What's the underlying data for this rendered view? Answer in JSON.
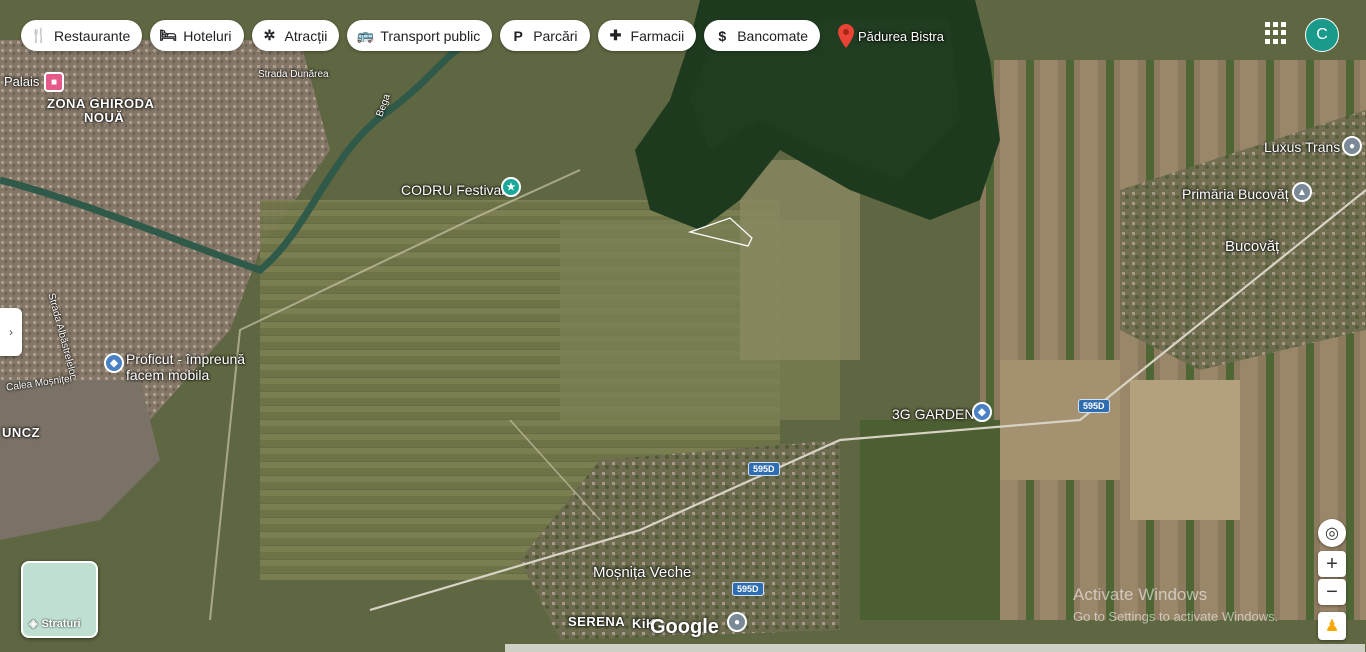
{
  "chips": [
    {
      "label": "Restaurante",
      "icon": "fork-knife-icon",
      "glyph": "🍴"
    },
    {
      "label": "Hoteluri",
      "icon": "bed-icon",
      "glyph": "🛏"
    },
    {
      "label": "Atracții",
      "icon": "attraction-icon",
      "glyph": "✲"
    },
    {
      "label": "Transport public",
      "icon": "bus-icon",
      "glyph": "🚌"
    },
    {
      "label": "Parcări",
      "icon": "parking-icon",
      "glyph": "P"
    },
    {
      "label": "Farmacii",
      "icon": "pharmacy-icon",
      "glyph": "✚"
    },
    {
      "label": "Bancomate",
      "icon": "atm-icon",
      "glyph": "$"
    }
  ],
  "search_pin": {
    "label": "Pădurea Bistra",
    "color": "#ea4335"
  },
  "labels": {
    "palais": "Palais",
    "zona1": "ZONA GHIRODA",
    "zona2": "NOUĂ",
    "strada_dunarea": "Strada Dunărea",
    "bega": "Bega",
    "codru": "CODRU Festival",
    "strada_albastrelelor": "Strada Albăstrelelor",
    "proficut1": "Proficut - împreună",
    "proficut2": "facem mobila",
    "calea_mosnitei": "Calea Moșniței",
    "uncz": "UNCZ",
    "luxus": "Luxus Trans",
    "primaria": "Primăria Bucovăț",
    "bucovat": "Bucovăț",
    "garden": "3G GARDEN",
    "mosnita": "Moșnița Veche",
    "serena": "SERENA",
    "kik": "KiK",
    "road_595d": "595D"
  },
  "account_initial": "C",
  "layers_label": "Straturi",
  "google_logo": "Google",
  "watermark": {
    "line1": "Activate Windows",
    "line2": "Go to Settings to activate Windows."
  },
  "colors": {
    "chip_bg": "#ffffff",
    "avatar": "#1a9a8a",
    "pin_blue": "#4a80c4",
    "pin_teal": "#1aa89a",
    "road_badge": "#2f6db1"
  }
}
